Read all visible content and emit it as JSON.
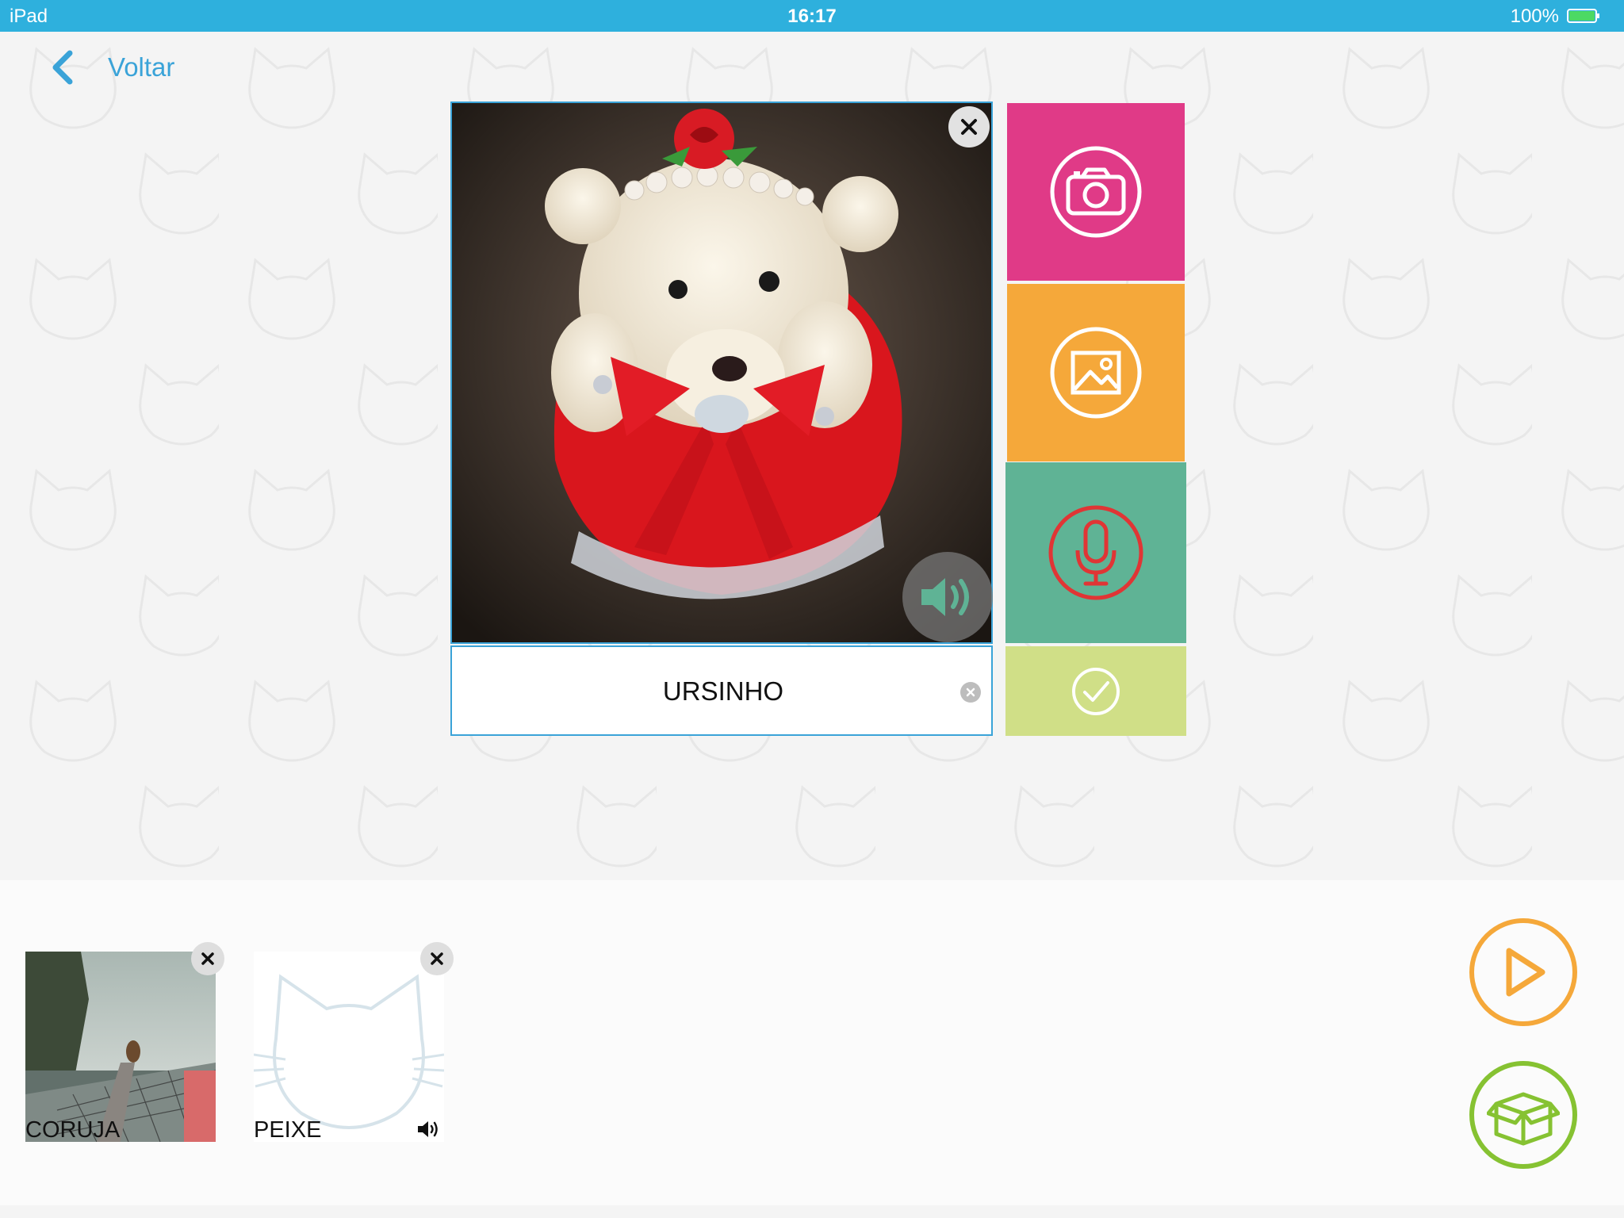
{
  "status_bar": {
    "device": "iPad",
    "time": "16:17",
    "battery": "100%"
  },
  "nav": {
    "back_label": "Voltar"
  },
  "editor": {
    "word_value": "URSINHO",
    "icons": {
      "close": "close-icon",
      "sound": "speaker-icon",
      "clear": "clear-icon",
      "camera": "camera-icon",
      "gallery": "image-icon",
      "mic": "microphone-icon",
      "confirm": "check-icon"
    },
    "colors": {
      "camera": "#e03a87",
      "gallery": "#f5a83a",
      "mic": "#5fb395",
      "mic_icon": "#e03535",
      "confirm": "#d0df87",
      "accent": "#3aa3d8"
    }
  },
  "tray": {
    "cards": [
      {
        "label": "CORUJA"
      },
      {
        "label": "PEIXE"
      }
    ],
    "play_icon": "play-icon",
    "box_icon": "box-icon"
  }
}
